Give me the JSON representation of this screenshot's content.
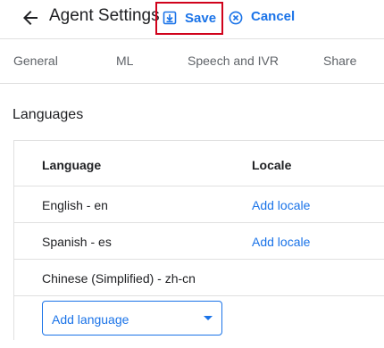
{
  "header": {
    "title": "Agent Settings",
    "save_label": "Save",
    "cancel_label": "Cancel"
  },
  "tabs": [
    {
      "label": "General"
    },
    {
      "label": "ML"
    },
    {
      "label": "Speech and IVR"
    },
    {
      "label": "Share"
    }
  ],
  "languages": {
    "section_title": "Languages",
    "columns": {
      "language": "Language",
      "locale": "Locale"
    },
    "rows": [
      {
        "language": "English - en",
        "locale_action": "Add locale"
      },
      {
        "language": "Spanish - es",
        "locale_action": "Add locale"
      },
      {
        "language": "Chinese (Simplified) - zh-cn",
        "locale_action": ""
      }
    ],
    "add_language_label": "Add language"
  },
  "colors": {
    "accent": "#1a73e8",
    "highlight_border": "#d0021b",
    "divider": "#e0e0e0"
  }
}
